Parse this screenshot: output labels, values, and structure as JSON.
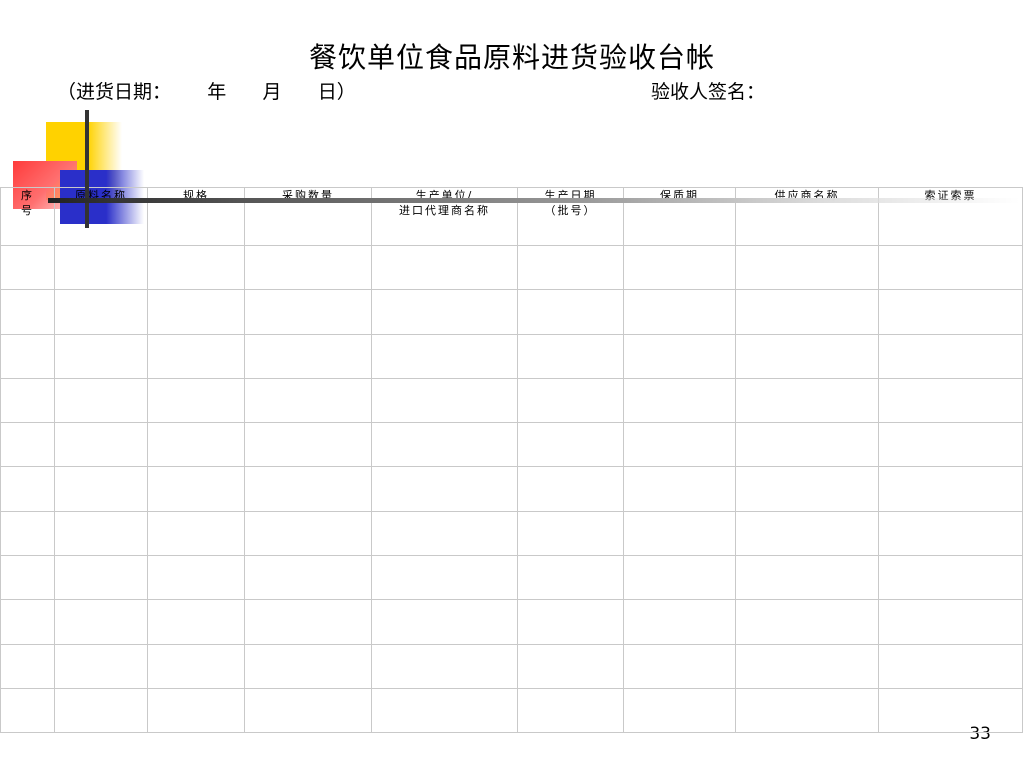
{
  "title": "餐饮单位食品原料进货验收台帐",
  "date_line": "（进货日期：      年      月      日）",
  "signer_label": "验收人签名：",
  "table": {
    "headers": [
      "序\n号",
      "原料名称",
      "规格",
      "采购数量",
      "生产单位/\n进口代理商名称",
      "生产日期\n（批号）",
      "保质期",
      "供应商名称",
      "索证索票"
    ],
    "empty_rows": 11
  },
  "slide_number": "33",
  "colors": {
    "deco_yellow": "#ffd200",
    "deco_red": "#ff3b3b",
    "deco_blue": "#2a2fc9",
    "grid_line": "#c9c9c9"
  }
}
